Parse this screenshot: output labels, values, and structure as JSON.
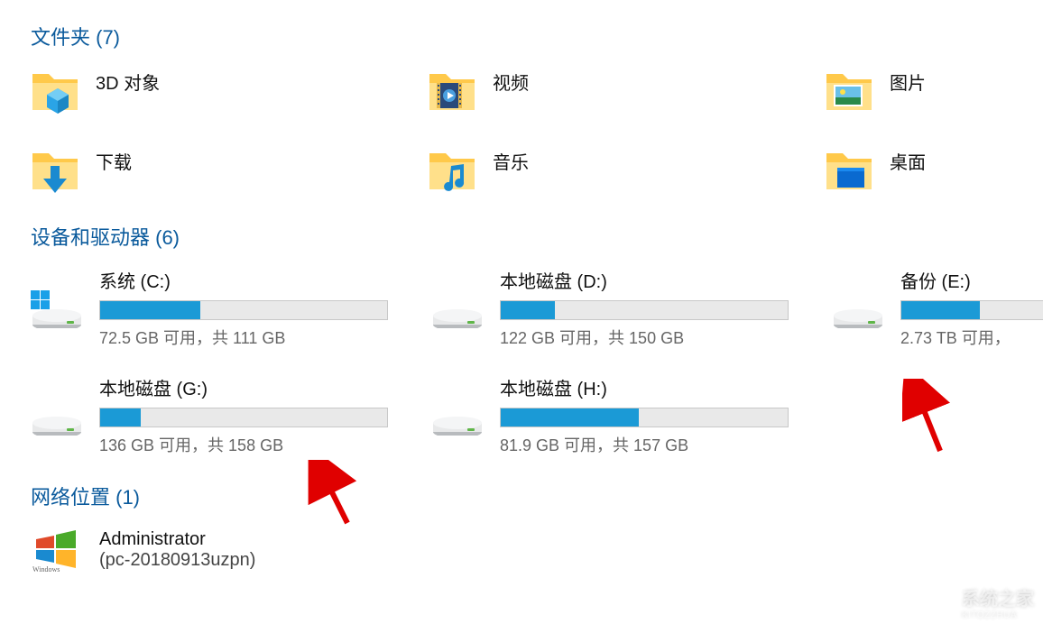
{
  "sections": {
    "folders": {
      "title": "文件夹 (7)"
    },
    "drives": {
      "title": "设备和驱动器 (6)"
    },
    "network": {
      "title": "网络位置 (1)"
    }
  },
  "folders": [
    {
      "label": "3D 对象",
      "icon": "3d-objects"
    },
    {
      "label": "视频",
      "icon": "videos"
    },
    {
      "label": "图片",
      "icon": "pictures"
    },
    {
      "label": "下载",
      "icon": "downloads"
    },
    {
      "label": "音乐",
      "icon": "music"
    },
    {
      "label": "桌面",
      "icon": "desktop"
    }
  ],
  "drives": [
    {
      "name": "系统 (C:)",
      "stats": "72.5 GB 可用，共 111 GB",
      "fill_percent": 35,
      "icon": "win-drive"
    },
    {
      "name": "本地磁盘 (D:)",
      "stats": "122 GB 可用，共 150 GB",
      "fill_percent": 19,
      "icon": "hdd"
    },
    {
      "name": "备份 (E:)",
      "stats": "2.73 TB 可用，",
      "fill_percent": 55,
      "icon": "hdd",
      "truncated": true
    },
    {
      "name": "本地磁盘 (G:)",
      "stats": "136 GB 可用，共 158 GB",
      "fill_percent": 14,
      "icon": "hdd"
    },
    {
      "name": "本地磁盘 (H:)",
      "stats": "81.9 GB 可用，共 157 GB",
      "fill_percent": 48,
      "icon": "hdd"
    },
    null
  ],
  "network": {
    "name": "Administrator",
    "detail": "(pc-20180913uzpn)",
    "icon": "wmp"
  },
  "watermark": {
    "brand": "系统之家",
    "sub": "KITOZZHUA"
  }
}
